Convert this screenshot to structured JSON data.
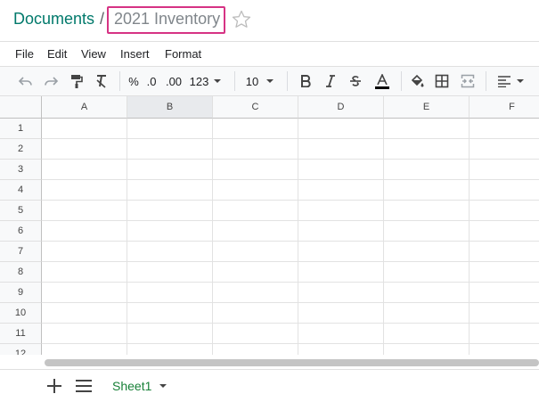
{
  "breadcrumb": {
    "root": "Documents",
    "separator": "/"
  },
  "document": {
    "title": "2021 Inventory"
  },
  "menu": [
    "File",
    "Edit",
    "View",
    "Insert",
    "Format"
  ],
  "toolbar": {
    "percent": "%",
    "decrease_decimal": ".0",
    "increase_decimal": ".00",
    "number_format": "123",
    "font_size": "10",
    "text_color": "#000000"
  },
  "grid": {
    "columns": [
      "A",
      "B",
      "C",
      "D",
      "E",
      "F"
    ],
    "selected_column": "B",
    "rows": [
      "1",
      "2",
      "3",
      "4",
      "5",
      "6",
      "7",
      "8",
      "9",
      "10",
      "11",
      "12"
    ]
  },
  "sheets": {
    "active": "Sheet1"
  },
  "colors": {
    "brand": "#00796b",
    "highlight": "#d63384",
    "sheet_tab": "#188038"
  },
  "icons": [
    "star-icon",
    "undo-icon",
    "redo-icon",
    "paint-format-icon",
    "clear-format-icon",
    "bold-icon",
    "italic-icon",
    "strikethrough-icon",
    "text-color-icon",
    "fill-color-icon",
    "borders-icon",
    "merge-cells-icon",
    "align-icon",
    "add-icon",
    "menu-icon",
    "caret-down-icon"
  ]
}
